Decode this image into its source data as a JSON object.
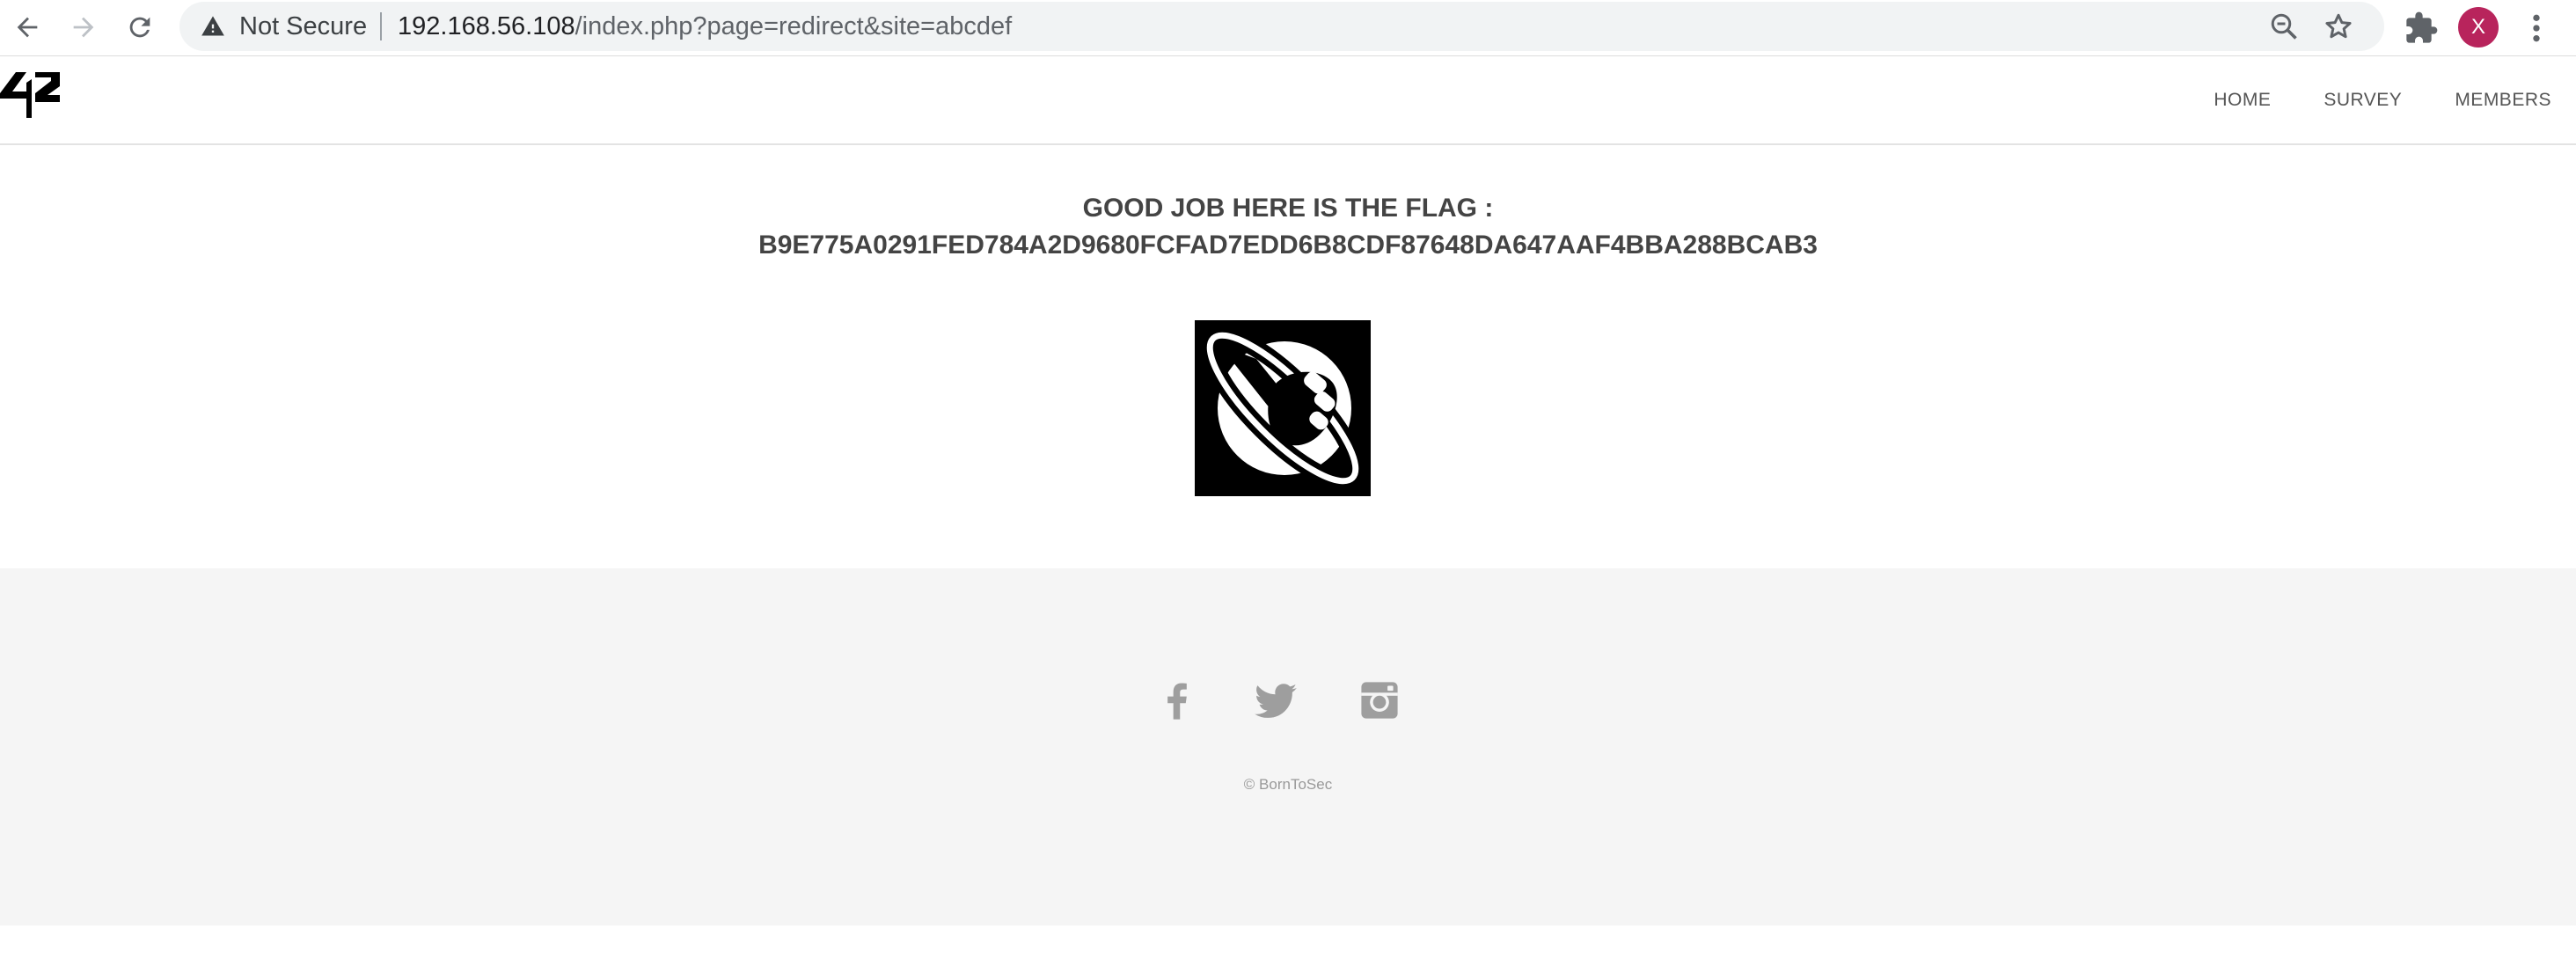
{
  "browser": {
    "security_label": "Not Secure",
    "url_host": "192.168.56.108",
    "url_path": "/index.php?page=redirect&site=abcdef",
    "profile_initial": "X"
  },
  "nav": {
    "home": "HOME",
    "survey": "SURVEY",
    "members": "MEMBERS"
  },
  "main": {
    "flag_title": "GOOD JOB HERE IS THE FLAG :",
    "flag_value": "B9E775A0291FED784A2D9680FCFAD7EDD6B8CDF87648DA647AAF4BBA288BCAB3"
  },
  "footer": {
    "social": [
      "facebook-icon",
      "twitter-icon",
      "instagram-icon"
    ],
    "copyright": "© BornToSec"
  }
}
